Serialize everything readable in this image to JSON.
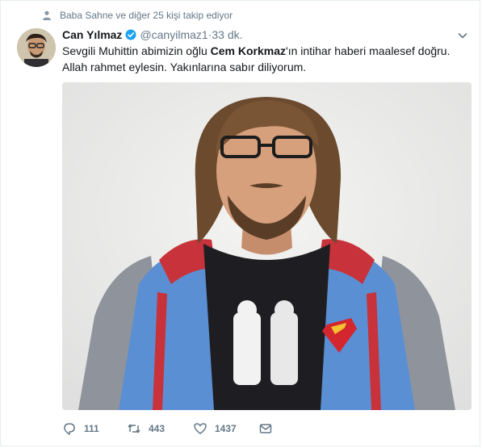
{
  "social_context": {
    "text": "Baba Sahne ve diğer 25 kişi takip ediyor",
    "icon": "person-icon"
  },
  "tweet": {
    "display_name": "Can Yılmaz",
    "handle": "@canyilmaz1",
    "separator": " · ",
    "time": "33 dk.",
    "text_part1": "Sevgili Muhittin abimizin oğlu ",
    "text_bold": "Cem Korkmaz",
    "text_part2": "'ın intihar haberi maalesef doğru.",
    "text_line2": "Allah rahmet eylesin. Yakınlarına sabır diliyorum."
  },
  "actions": {
    "reply_count": "111",
    "retweet_count": "443",
    "like_count": "1437"
  },
  "colors": {
    "accent": "#1da1f2",
    "muted": "#657786",
    "text": "#14171a"
  }
}
